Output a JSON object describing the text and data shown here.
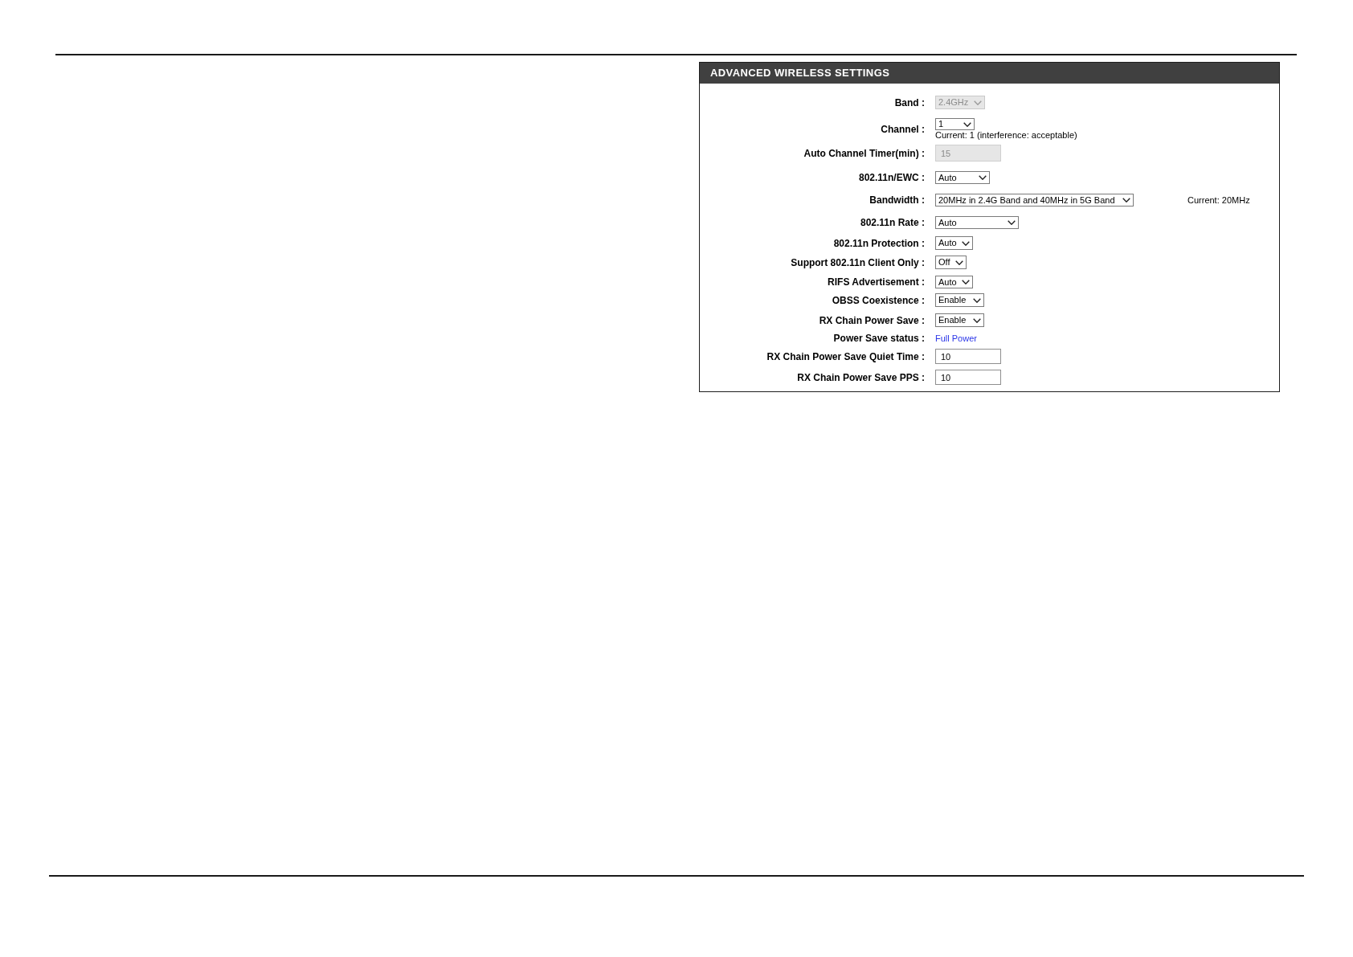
{
  "panel": {
    "title": "ADVANCED WIRELESS SETTINGS",
    "rows": [
      {
        "label": "Band :",
        "kind": "select",
        "value": "2.4GHz",
        "disabled": true
      },
      {
        "label": "Channel :",
        "kind": "select",
        "value": "1",
        "disabled": false,
        "note": "Current: 1 (interference: acceptable)"
      },
      {
        "label": "Auto Channel Timer(min) :",
        "kind": "input",
        "value": "15",
        "disabled": true
      },
      {
        "label": "802.11n/EWC :",
        "kind": "select",
        "value": "Auto",
        "disabled": false
      },
      {
        "label": "Bandwidth :",
        "kind": "select",
        "value": "20MHz in 2.4G Band and 40MHz in 5G Band",
        "disabled": false,
        "aside": "Current: 20MHz"
      },
      {
        "label": "802.11n Rate :",
        "kind": "select",
        "value": "Auto",
        "disabled": false
      },
      {
        "label": "802.11n Protection :",
        "kind": "select",
        "value": "Auto",
        "disabled": false
      },
      {
        "label": "Support 802.11n Client Only :",
        "kind": "select",
        "value": "Off",
        "disabled": false
      },
      {
        "label": "RIFS Advertisement :",
        "kind": "select",
        "value": "Auto",
        "disabled": false
      },
      {
        "label": "OBSS Coexistence :",
        "kind": "select",
        "value": "Enable",
        "disabled": false
      },
      {
        "label": "RX Chain Power Save :",
        "kind": "select",
        "value": "Enable",
        "disabled": false
      },
      {
        "label": "Power Save status :",
        "kind": "status",
        "value": "Full Power",
        "disabled": false
      },
      {
        "label": "RX Chain Power Save Quiet Time :",
        "kind": "input",
        "value": "10",
        "disabled": false
      },
      {
        "label": "RX Chain Power Save PPS :",
        "kind": "input",
        "value": "10",
        "disabled": false
      }
    ]
  }
}
